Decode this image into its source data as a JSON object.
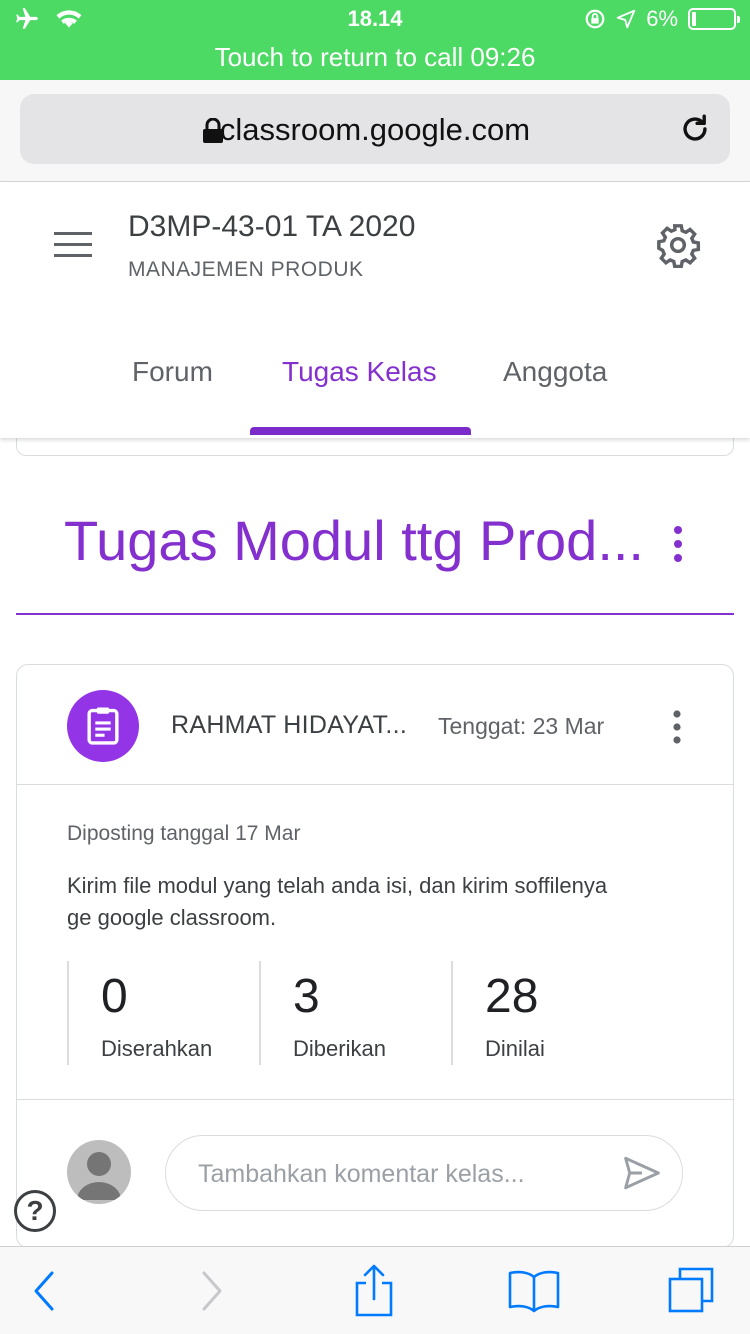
{
  "status_bar": {
    "time": "18.14",
    "call_banner": "Touch to return to call 09:26",
    "battery": "6%",
    "battery_level": 0.06,
    "accent_color": "#4cd964"
  },
  "browser": {
    "url": "classroom.google.com",
    "icons": [
      "lock-icon",
      "reload-icon"
    ]
  },
  "header": {
    "class_name": "D3MP-43-01 TA 2020",
    "class_subtitle": "MANAJEMEN PRODUK",
    "tabs": [
      {
        "label": "Forum",
        "active": false
      },
      {
        "label": "Tugas Kelas",
        "active": true
      },
      {
        "label": "Anggota",
        "active": false
      }
    ],
    "accent_color": "#8430ce"
  },
  "topic": {
    "title": "Tugas Modul ttg Prod..."
  },
  "assignment": {
    "author": "RAHMAT HIDAYAT...",
    "due": "Tenggat: 23 Mar",
    "posted": "Diposting tanggal 17 Mar",
    "description": "Kirim file modul yang telah anda isi, dan kirim soffilenya ge google classroom.",
    "stats": [
      {
        "value": "0",
        "label": "Diserahkan"
      },
      {
        "value": "3",
        "label": "Diberikan"
      },
      {
        "value": "28",
        "label": "Dinilai"
      }
    ],
    "icon_color": "#9334e6"
  },
  "comment": {
    "placeholder": "Tambahkan komentar kelas..."
  },
  "help": {
    "label": "?"
  },
  "toolbar": {
    "icons": [
      "back-icon",
      "forward-icon",
      "share-icon",
      "bookmarks-icon",
      "tabs-icon"
    ]
  }
}
